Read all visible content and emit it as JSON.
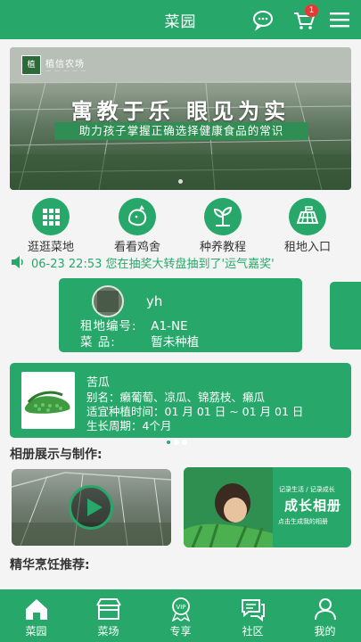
{
  "header": {
    "title": "菜园",
    "cart_badge": "1",
    "icons": [
      "chat-icon",
      "cart-icon",
      "menu-icon"
    ]
  },
  "banner": {
    "brand": "植信农场",
    "headline": "寓教于乐  眼见为实",
    "subtitle": "助力孩子掌握正确选择健康食品的常识"
  },
  "quicknav": [
    {
      "label": "逛逛菜地",
      "icon": "grid-icon"
    },
    {
      "label": "看看鸡舍",
      "icon": "chicken-icon"
    },
    {
      "label": "种养教程",
      "icon": "sprout-icon"
    },
    {
      "label": "租地入口",
      "icon": "field-icon"
    }
  ],
  "notice": {
    "text": "06-23 22:53 您在抽奖大转盘抽到了'运气嘉奖'"
  },
  "plot": {
    "username": "yh",
    "plot_label": "租地编号:",
    "plot_value": "A1-NE",
    "crop_label": "菜      品:",
    "crop_value": "暂未种植"
  },
  "crop": {
    "title": "苦瓜",
    "alias": "别名：癞葡萄、凉瓜、锦荔枝、癞瓜",
    "season": "适宜种植时间：01 月 01 日 ~ 01 月 01 日",
    "cycle": "生长周期：4个月"
  },
  "sections": {
    "album": "相册展示与制作:",
    "recipes": "精华烹饪推荐:"
  },
  "album": {
    "grow_small": "记录生活 / 记录成长",
    "grow_title": "成长相册",
    "grow_sub": "点击生成我的相册"
  },
  "tabbar": [
    {
      "label": "菜园",
      "icon": "home-icon"
    },
    {
      "label": "菜场",
      "icon": "market-icon"
    },
    {
      "label": "专享",
      "icon": "vip-icon"
    },
    {
      "label": "社区",
      "icon": "community-icon"
    },
    {
      "label": "我的",
      "icon": "user-icon"
    }
  ],
  "colors": {
    "primary": "#27a86a",
    "badge": "#e53935",
    "background": "#f4f4f4"
  }
}
